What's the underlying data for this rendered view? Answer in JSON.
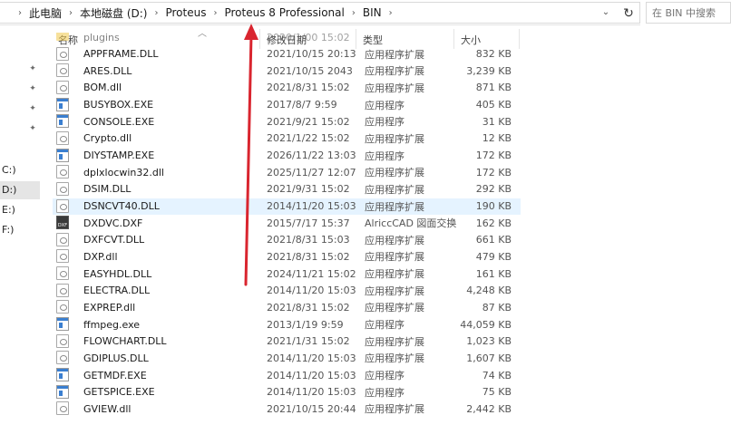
{
  "breadcrumb": [
    "此电脑",
    "本地磁盘 (D:)",
    "Proteus",
    "Proteus 8 Professional",
    "BIN"
  ],
  "search": {
    "placeholder": "在 BIN 中搜索"
  },
  "columns": {
    "name": "名称",
    "date": "修改日期",
    "type": "类型",
    "size": "大小"
  },
  "nav": {
    "drives": [
      "C:)",
      "D:)",
      "E:)",
      "F:)"
    ],
    "selected_drive_index": 1
  },
  "files": [
    {
      "name": "plugins",
      "date": "2020/1/00 15:02",
      "type": "",
      "size": "",
      "icon": "folder"
    },
    {
      "name": "APPFRAME.DLL",
      "date": "2021/10/15 20:13",
      "type": "应用程序扩展",
      "size": "832 KB",
      "icon": "dll"
    },
    {
      "name": "ARES.DLL",
      "date": "2021/10/15 2043",
      "type": "应用程序扩展",
      "size": "3,239 KB",
      "icon": "dll"
    },
    {
      "name": "BOM.dll",
      "date": "2021/8/31 15:02",
      "type": "应用程序扩展",
      "size": "871 KB",
      "icon": "dll"
    },
    {
      "name": "BUSYBOX.EXE",
      "date": "2017/8/7 9:59",
      "type": "应用程序",
      "size": "405 KB",
      "icon": "exe"
    },
    {
      "name": "CONSOLE.EXE",
      "date": "2021/9/21 15:02",
      "type": "应用程序",
      "size": "31 KB",
      "icon": "exe"
    },
    {
      "name": "Crypto.dll",
      "date": "2021/1/22 15:02",
      "type": "应用程序扩展",
      "size": "12 KB",
      "icon": "dll"
    },
    {
      "name": "DIYSTAMP.EXE",
      "date": "2026/11/22 13:03",
      "type": "应用程序",
      "size": "172 KB",
      "icon": "exe"
    },
    {
      "name": "dplxlocwin32.dll",
      "date": "2025/11/27 12:07",
      "type": "应用程序扩展",
      "size": "172 KB",
      "icon": "dll"
    },
    {
      "name": "DSIM.DLL",
      "date": "2021/9/31 15:02",
      "type": "应用程序扩展",
      "size": "292 KB",
      "icon": "dll"
    },
    {
      "name": "DSNCVT40.DLL",
      "date": "2014/11/20 15:03",
      "type": "应用程序扩展",
      "size": "190 KB",
      "icon": "dll",
      "highlight": true
    },
    {
      "name": "DXDVC.DXF",
      "date": "2015/7/17 15:37",
      "type": "AlriccCAD 図面交换",
      "size": "162 KB",
      "icon": "dxf"
    },
    {
      "name": "DXFCVT.DLL",
      "date": "2021/8/31 15:03",
      "type": "应用程序扩展",
      "size": "661 KB",
      "icon": "dll"
    },
    {
      "name": "DXP.dll",
      "date": "2021/8/31 15:02",
      "type": "应用程序扩展",
      "size": "479 KB",
      "icon": "dll"
    },
    {
      "name": "EASYHDL.DLL",
      "date": "2024/11/21 15:02",
      "type": "应用程序扩展",
      "size": "161 KB",
      "icon": "dll"
    },
    {
      "name": "ELECTRA.DLL",
      "date": "2014/11/20 15:03",
      "type": "应用程序扩展",
      "size": "4,248 KB",
      "icon": "dll"
    },
    {
      "name": "EXPREP.dll",
      "date": "2021/8/31 15:02",
      "type": "应用程序扩展",
      "size": "87 KB",
      "icon": "dll"
    },
    {
      "name": "ffmpeg.exe",
      "date": "2013/1/19 9:59",
      "type": "应用程序",
      "size": "44,059 KB",
      "icon": "exe"
    },
    {
      "name": "FLOWCHART.DLL",
      "date": "2021/1/31 15:02",
      "type": "应用程序扩展",
      "size": "1,023 KB",
      "icon": "dll"
    },
    {
      "name": "GDIPLUS.DLL",
      "date": "2014/11/20 15:03",
      "type": "应用程序扩展",
      "size": "1,607 KB",
      "icon": "dll"
    },
    {
      "name": "GETMDF.EXE",
      "date": "2014/11/20 15:03",
      "type": "应用程序",
      "size": "74 KB",
      "icon": "exe"
    },
    {
      "name": "GETSPICE.EXE",
      "date": "2014/11/20 15:03",
      "type": "应用程序",
      "size": "75 KB",
      "icon": "exe"
    },
    {
      "name": "GVIEW.dll",
      "date": "2021/10/15 20:44",
      "type": "应用程序扩展",
      "size": "2,442 KB",
      "icon": "dll"
    }
  ],
  "colors": {
    "highlight_row": "#e5f3ff",
    "annotation_arrow": "#d9252f",
    "exe_icon": "#3b7fd0"
  }
}
